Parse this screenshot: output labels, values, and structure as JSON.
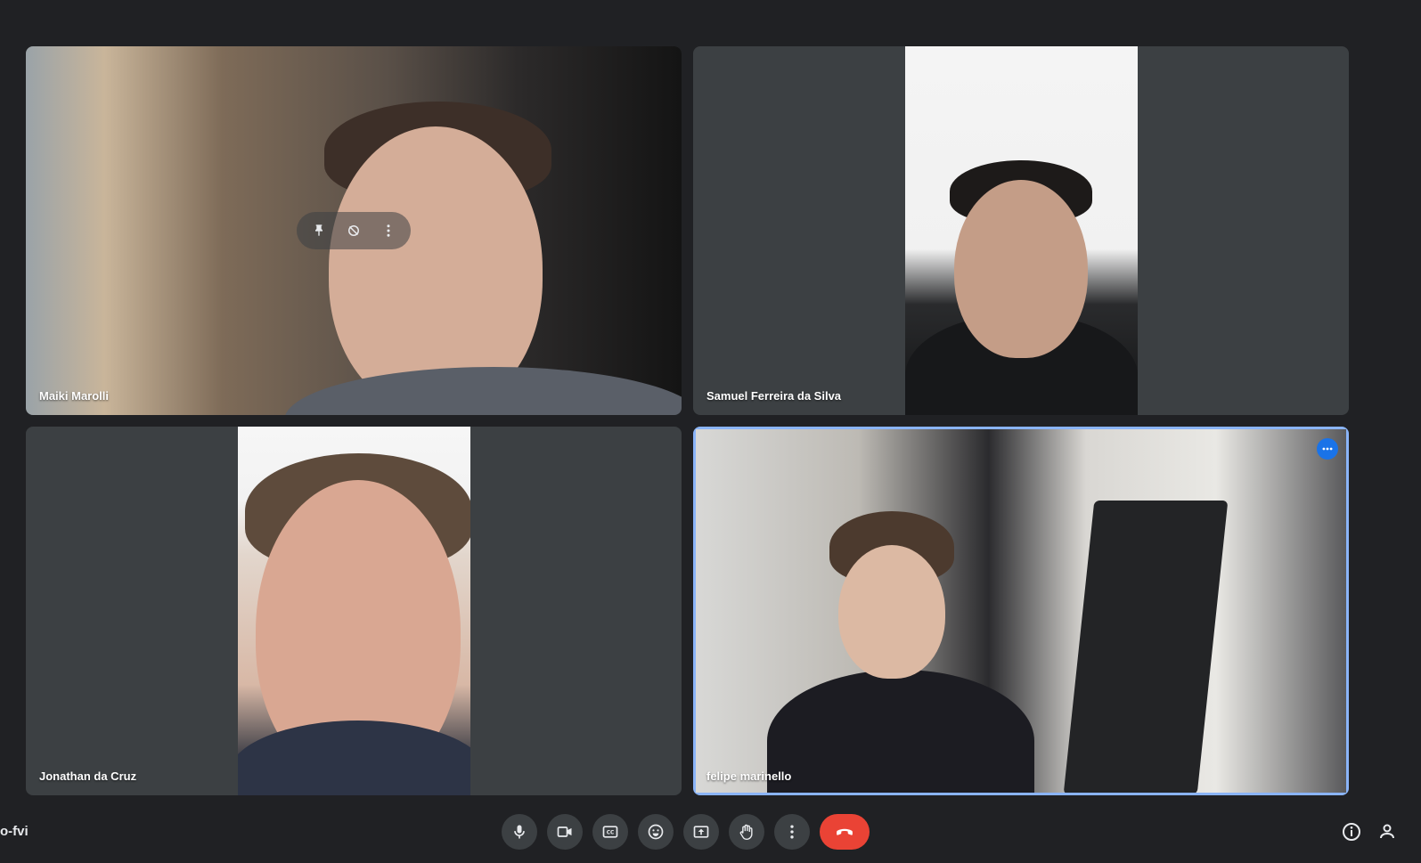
{
  "participants": [
    {
      "name": "Maiki Marolli"
    },
    {
      "name": "Samuel Ferreira da Silva"
    },
    {
      "name": "Jonathan da Cruz"
    },
    {
      "name": "felipe marinello"
    }
  ],
  "meeting": {
    "code_fragment": "o-fvi"
  },
  "controls": {
    "mic": "microphone-icon",
    "camera": "camera-icon",
    "captions": "captions-icon",
    "reactions": "emoji-icon",
    "present": "present-screen-icon",
    "raise_hand": "raise-hand-icon",
    "more": "more-options-icon",
    "leave": "leave-call-icon"
  },
  "colors": {
    "background": "#202124",
    "tile": "#3c4043",
    "control": "#3c4043",
    "leave_call": "#ea4335",
    "active_speaker_border": "#8ab4f8",
    "accent": "#1a73e8"
  }
}
